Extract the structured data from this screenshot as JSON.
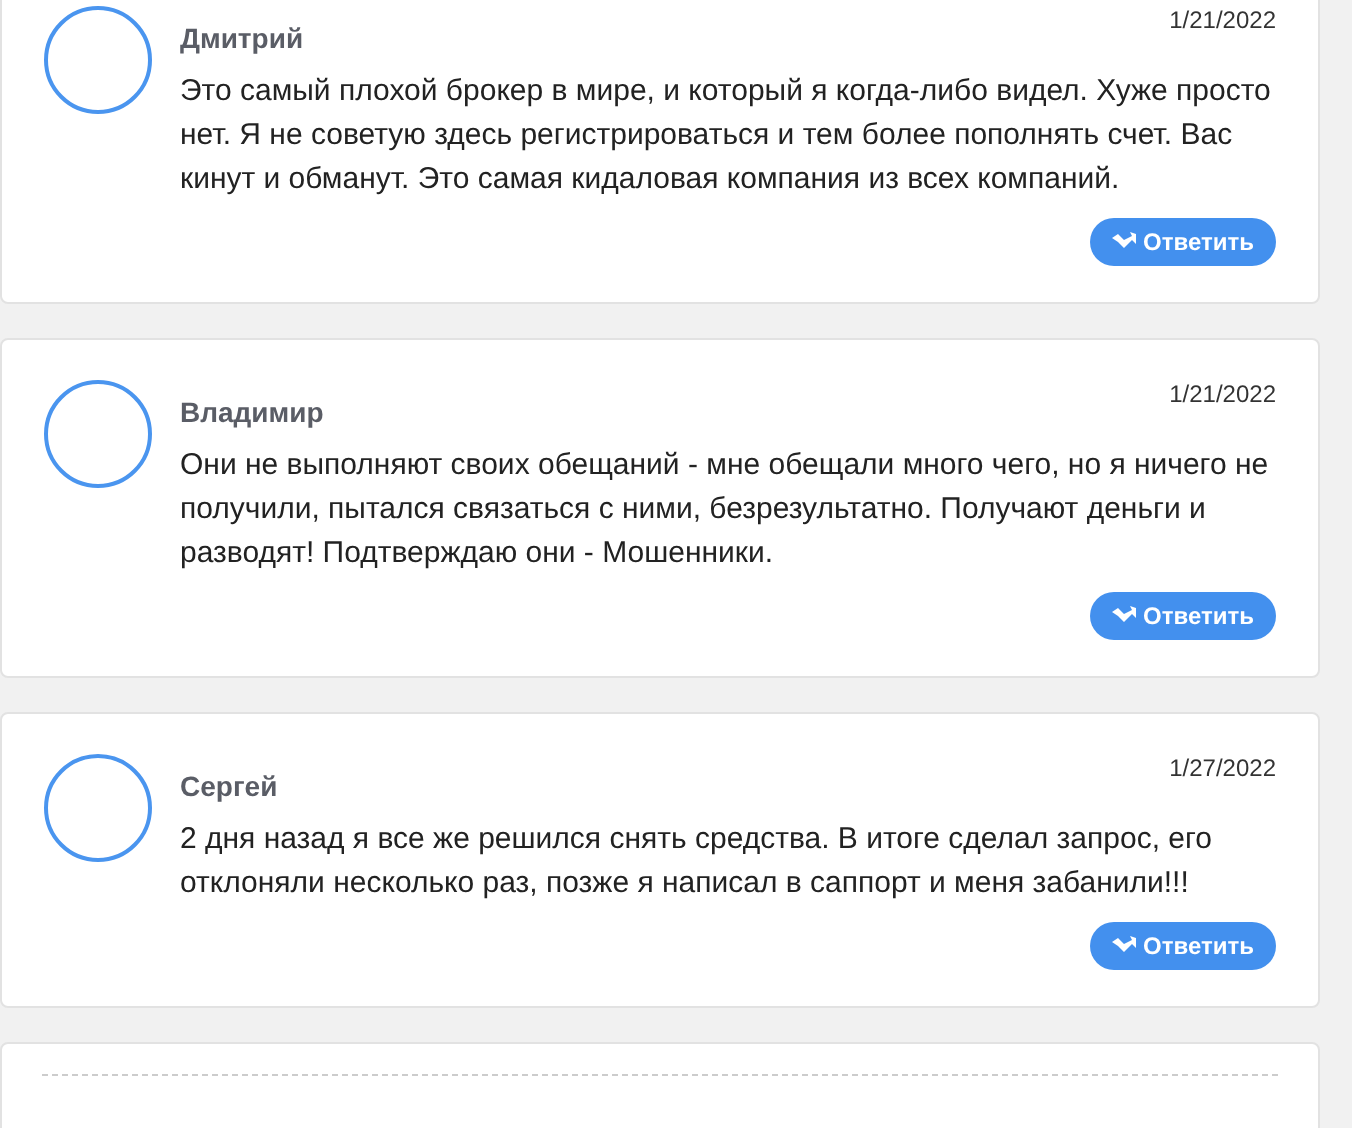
{
  "comments": [
    {
      "author": "Дмитрий",
      "date": "1/21/2022",
      "text": "Это самый плохой брокер в мире, и который я когда-либо видел. Хуже просто нет. Я не советую здесь регистрироваться и тем более пополнять счет. Вас кинут и обманут. Это самая кидаловая компания из всех компаний.",
      "reply_button": "Ответить"
    },
    {
      "author": "Владимир",
      "date": "1/21/2022",
      "text": "Они не выполняют своих обещаний - мне обещали много чего, но я ничего не получили, пытался связаться с ними, безрезультатно. Получают деньги и разводят! Подтверждаю они - Мошенники.",
      "reply_button": "Ответить"
    },
    {
      "author": "Сергей",
      "date": "1/27/2022",
      "text": "2 дня назад я все же решился снять средства. В итоге сделал запрос, его отклоняли несколько раз, позже я написал в саппорт и меня забанили!!!",
      "reply_button": "Ответить"
    }
  ]
}
